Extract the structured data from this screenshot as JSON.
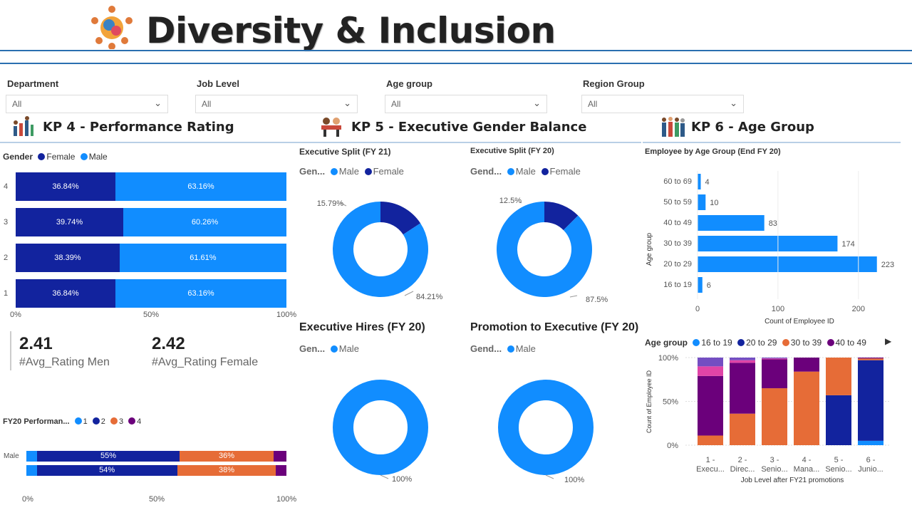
{
  "header": {
    "title": "Diversity & Inclusion"
  },
  "slicers": [
    {
      "label": "Department",
      "value": "All"
    },
    {
      "label": "Job Level",
      "value": "All"
    },
    {
      "label": "Age group",
      "value": "All"
    },
    {
      "label": "Region Group",
      "value": "All"
    }
  ],
  "sections": {
    "kp4": "KP 4 - Performance Rating",
    "kp5": "KP 5 - Executive Gender Balance",
    "kp6": "KP 6 - Age Group"
  },
  "colors": {
    "female": "#12239e",
    "male": "#118dff",
    "orange": "#e66c37",
    "purple": "#6b007b",
    "pink": "#e044a7",
    "blue_line": "#2a6fb0"
  },
  "perf_rating": {
    "legend_title": "Gender",
    "legend": [
      "Female",
      "Male"
    ],
    "axis": [
      "0%",
      "50%",
      "100%"
    ],
    "rows": [
      {
        "cat": "4",
        "female": 36.84,
        "male": 63.16,
        "f_label": "36.84%",
        "m_label": "63.16%"
      },
      {
        "cat": "3",
        "female": 39.74,
        "male": 60.26,
        "f_label": "39.74%",
        "m_label": "60.26%"
      },
      {
        "cat": "2",
        "female": 38.39,
        "male": 61.61,
        "f_label": "38.39%",
        "m_label": "61.61%"
      },
      {
        "cat": "1",
        "female": 36.84,
        "male": 63.16,
        "f_label": "36.84%",
        "m_label": "63.16%"
      }
    ]
  },
  "kpis": [
    {
      "value": "2.41",
      "label": "#Avg_Rating Men"
    },
    {
      "value": "2.42",
      "label": "#Avg_Rating Female"
    }
  ],
  "fy20_perf": {
    "title": "FY20 Performan...",
    "legend": [
      "1",
      "2",
      "3",
      "4"
    ],
    "axis": [
      "0%",
      "50%",
      "100%"
    ],
    "rows": [
      {
        "cat": "Male",
        "values": [
          4,
          55,
          36,
          5
        ],
        "labels": [
          "",
          "55%",
          "36%",
          ""
        ]
      },
      {
        "cat": "",
        "values": [
          4,
          54,
          38,
          4
        ],
        "labels": [
          "",
          "54%",
          "38%",
          ""
        ]
      }
    ]
  },
  "exec": {
    "fy21": {
      "title": "Executive Split (FY 21)",
      "legend_title": "Gen...",
      "legend": [
        "Male",
        "Female"
      ],
      "male": 84.21,
      "female": 15.79,
      "male_label": "84.21%",
      "female_label": "15.79%"
    },
    "fy20": {
      "title": "Executive Split (FY 20)",
      "legend_title": "Gend...",
      "legend": [
        "Male",
        "Female"
      ],
      "male": 87.5,
      "female": 12.5,
      "male_label": "87.5%",
      "female_label": "12.5%"
    },
    "hires": {
      "title": "Executive Hires (FY 20)",
      "legend_title": "Gen...",
      "legend": [
        "Male"
      ],
      "male": 100,
      "male_label": "100%"
    },
    "promo": {
      "title": "Promotion to Executive (FY 20)",
      "legend_title": "Gend...",
      "legend": [
        "Male"
      ],
      "male": 100,
      "male_label": "100%"
    }
  },
  "age_group": {
    "title": "Employee by Age Group (End FY 20)",
    "ylabel": "Age group",
    "xlabel": "Count of Employee ID",
    "axis": [
      "0",
      "100",
      "200"
    ]
  },
  "job_level": {
    "legend_title": "Age group",
    "legend": [
      "16 to 19",
      "20 to 29",
      "30 to 39",
      "40 to 49"
    ],
    "ylabel": "Count of Employee ID",
    "xlabel": "Job Level after FY21 promotions",
    "yaxis": [
      "100%",
      "50%",
      "0%"
    ],
    "cats": [
      [
        "1 -",
        "Execu..."
      ],
      [
        "2 -",
        "Direc..."
      ],
      [
        "3 -",
        "Senio..."
      ],
      [
        "4 -",
        "Mana..."
      ],
      [
        "5 -",
        "Senio..."
      ],
      [
        "6 -",
        "Junio..."
      ]
    ]
  },
  "chart_data": [
    {
      "type": "bar",
      "title": "Employee by Age Group (End FY 20)",
      "xlabel": "Count of Employee ID",
      "ylabel": "Age group",
      "categories": [
        "60 to 69",
        "50 to 59",
        "40 to 49",
        "30 to 39",
        "20 to 29",
        "16 to 19"
      ],
      "values": [
        4,
        10,
        83,
        174,
        223,
        6
      ],
      "xlim": [
        0,
        225
      ]
    },
    {
      "type": "bar",
      "stacked": true,
      "xlabel": "Job Level after FY21 promotions",
      "ylabel": "Count of Employee ID",
      "categories": [
        "1 - Execu...",
        "2 - Direc...",
        "3 - Senio...",
        "4 - Mana...",
        "5 - Senio...",
        "6 - Junio..."
      ],
      "series": [
        {
          "name": "16 to 19",
          "values": [
            0,
            0,
            0,
            0,
            0,
            5
          ]
        },
        {
          "name": "20 to 29",
          "values": [
            0,
            0,
            0,
            0,
            57,
            92
          ]
        },
        {
          "name": "30 to 39",
          "values": [
            11,
            36,
            65,
            84,
            43,
            2
          ]
        },
        {
          "name": "40 to 49",
          "values": [
            68,
            58,
            33,
            16,
            0,
            1
          ]
        },
        {
          "name": "pink",
          "values": [
            11,
            3,
            1,
            0,
            0,
            0
          ]
        },
        {
          "name": "purple2",
          "values": [
            10,
            3,
            1,
            0,
            0,
            0
          ]
        }
      ],
      "ylim": [
        0,
        100
      ]
    }
  ]
}
